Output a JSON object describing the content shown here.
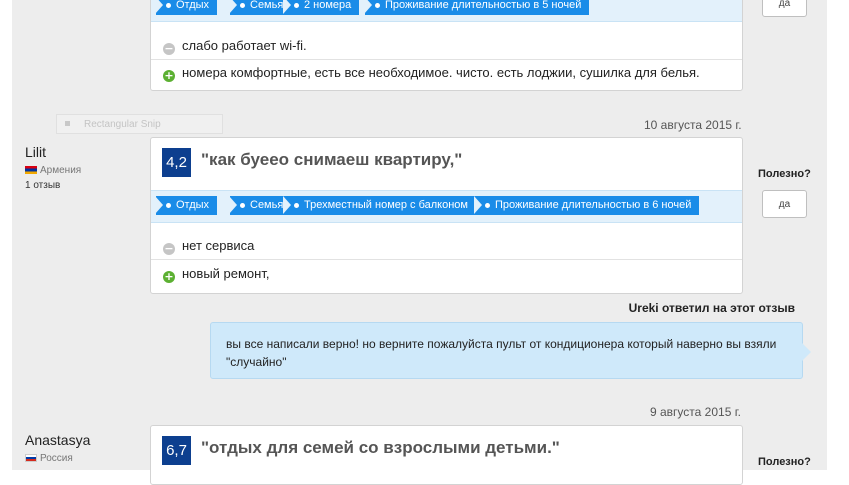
{
  "review1": {
    "tags": [
      "Отдых",
      "Семья",
      "2 номера",
      "Проживание длительностью в 5 ночей"
    ],
    "con": "слабо работает wi-fi.",
    "pro": "номера комфортные, есть все необходимое. чисто. есть лоджии, сушилка для белья.",
    "yes_label": "да"
  },
  "snip_overlay": "Rectangular Snip",
  "review2": {
    "date": "10 августа 2015 г.",
    "user": "Lilit",
    "country": "Армения",
    "reviews_count": "1 отзыв",
    "score": "4,2",
    "title": "\"как буеео снимаеш квартиру,\"",
    "tags": [
      "Отдых",
      "Семья",
      "Трехместный номер с балконом",
      "Проживание длительностью в 6 ночей"
    ],
    "con": "нет сервиса",
    "pro": "новый ремонт,",
    "helpful_label": "Полезно?",
    "yes_label": "да",
    "reply_header": "Ureki ответил на этот отзыв",
    "reply_text": "вы все написали верно! но верните пожалуйста пульт от кондиционера который наверно вы взяли \"случайно\""
  },
  "review3": {
    "date": "9 августа 2015 г.",
    "user": "Anastasya",
    "country": "Россия",
    "score": "6,7",
    "title": "\"отдых для семей со взрослыми детьми.\"",
    "helpful_label": "Полезно?"
  }
}
